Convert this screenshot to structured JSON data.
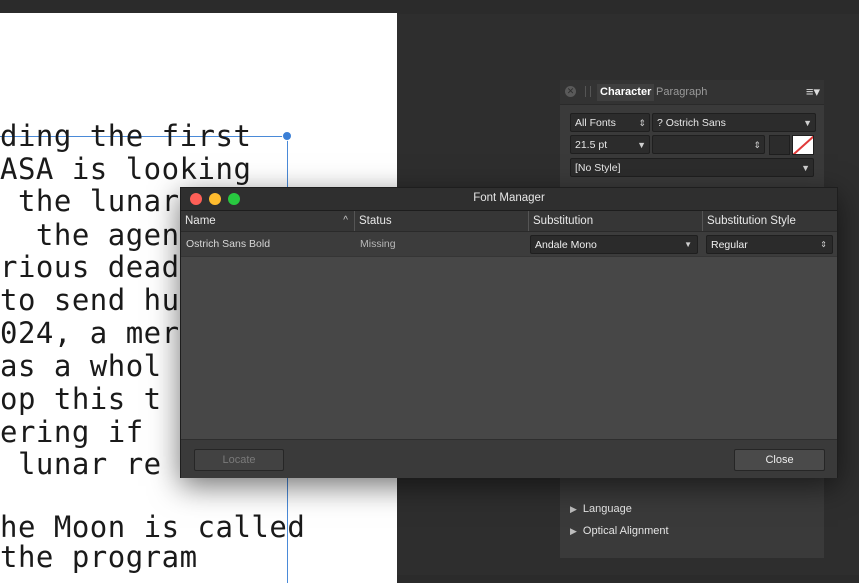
{
  "document": {
    "lines": [
      "ding the first",
      "ASA is looking",
      " the lunar",
      "  the agen",
      "rious dead",
      "to send hu",
      "024, a mer",
      "as a whol",
      "op this t",
      "ering if",
      " lunar re",
      "",
      "he Moon is called",
      "the program"
    ]
  },
  "character_panel": {
    "tabs": [
      "Character",
      "Paragraph"
    ],
    "active_tab": "Character",
    "font_collection": "All Fonts",
    "font_family": "? Ostrich Sans",
    "font_size": "21.5 pt",
    "font_style_value": "",
    "style": "[No Style]",
    "sections": [
      "Language",
      "Optical Alignment"
    ],
    "icons": {
      "close": "close-icon",
      "menu": "hamburger-menu-icon",
      "expand": "disclosure-triangle-icon"
    }
  },
  "font_manager": {
    "title": "Font Manager",
    "columns": [
      "Name",
      "Status",
      "Substitution",
      "Substitution Style"
    ],
    "sort_indicator": "^",
    "rows": [
      {
        "name": "Ostrich Sans Bold",
        "status": "Missing",
        "substitution": "Andale Mono",
        "substitution_style": "Regular"
      }
    ],
    "buttons": {
      "locate": "Locate",
      "close": "Close"
    },
    "colors": {
      "close_light": "#fe5f57",
      "minimize_light": "#febc2e",
      "zoom_light": "#28c840"
    }
  }
}
